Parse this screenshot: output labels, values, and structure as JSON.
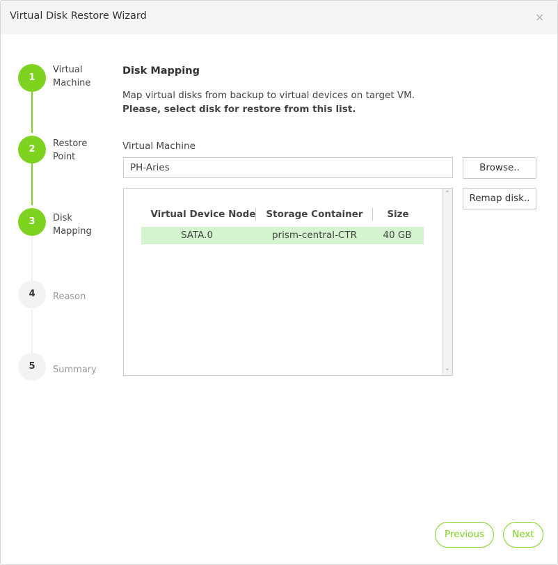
{
  "window": {
    "title": "Virtual Disk Restore Wizard",
    "close_glyph": "×"
  },
  "steps": [
    {
      "number": "1",
      "label": "Virtual Machine",
      "state": "completed"
    },
    {
      "number": "2",
      "label": "Restore Point",
      "state": "completed"
    },
    {
      "number": "3",
      "label": "Disk Mapping",
      "state": "current"
    },
    {
      "number": "4",
      "label": "Reason",
      "state": "pending"
    },
    {
      "number": "5",
      "label": "Summary",
      "state": "pending"
    }
  ],
  "main": {
    "title": "Disk Mapping",
    "description": "Map virtual disks from backup to virtual devices on target VM.",
    "instruction": "Please, select disk for restore from this list.",
    "vm_label": "Virtual Machine",
    "vm_value": "PH-Aries",
    "browse_label": "Browse..",
    "remap_label": "Remap disk.."
  },
  "table": {
    "columns": [
      "Virtual Device Node",
      "Storage Container",
      "Size"
    ],
    "rows": [
      {
        "node": "SATA.0",
        "container": "prism-central-CTR",
        "size": "40 GB",
        "selected": true
      }
    ]
  },
  "footer": {
    "previous_label": "Previous",
    "next_label": "Next"
  },
  "colors": {
    "accent": "#7ed321",
    "selected_row": "#d4f4cf",
    "inactive_step": "#f3f3f3"
  },
  "icons": {
    "close": "close-icon",
    "scroll_up": "chevron-up-icon",
    "scroll_down": "chevron-down-icon"
  }
}
